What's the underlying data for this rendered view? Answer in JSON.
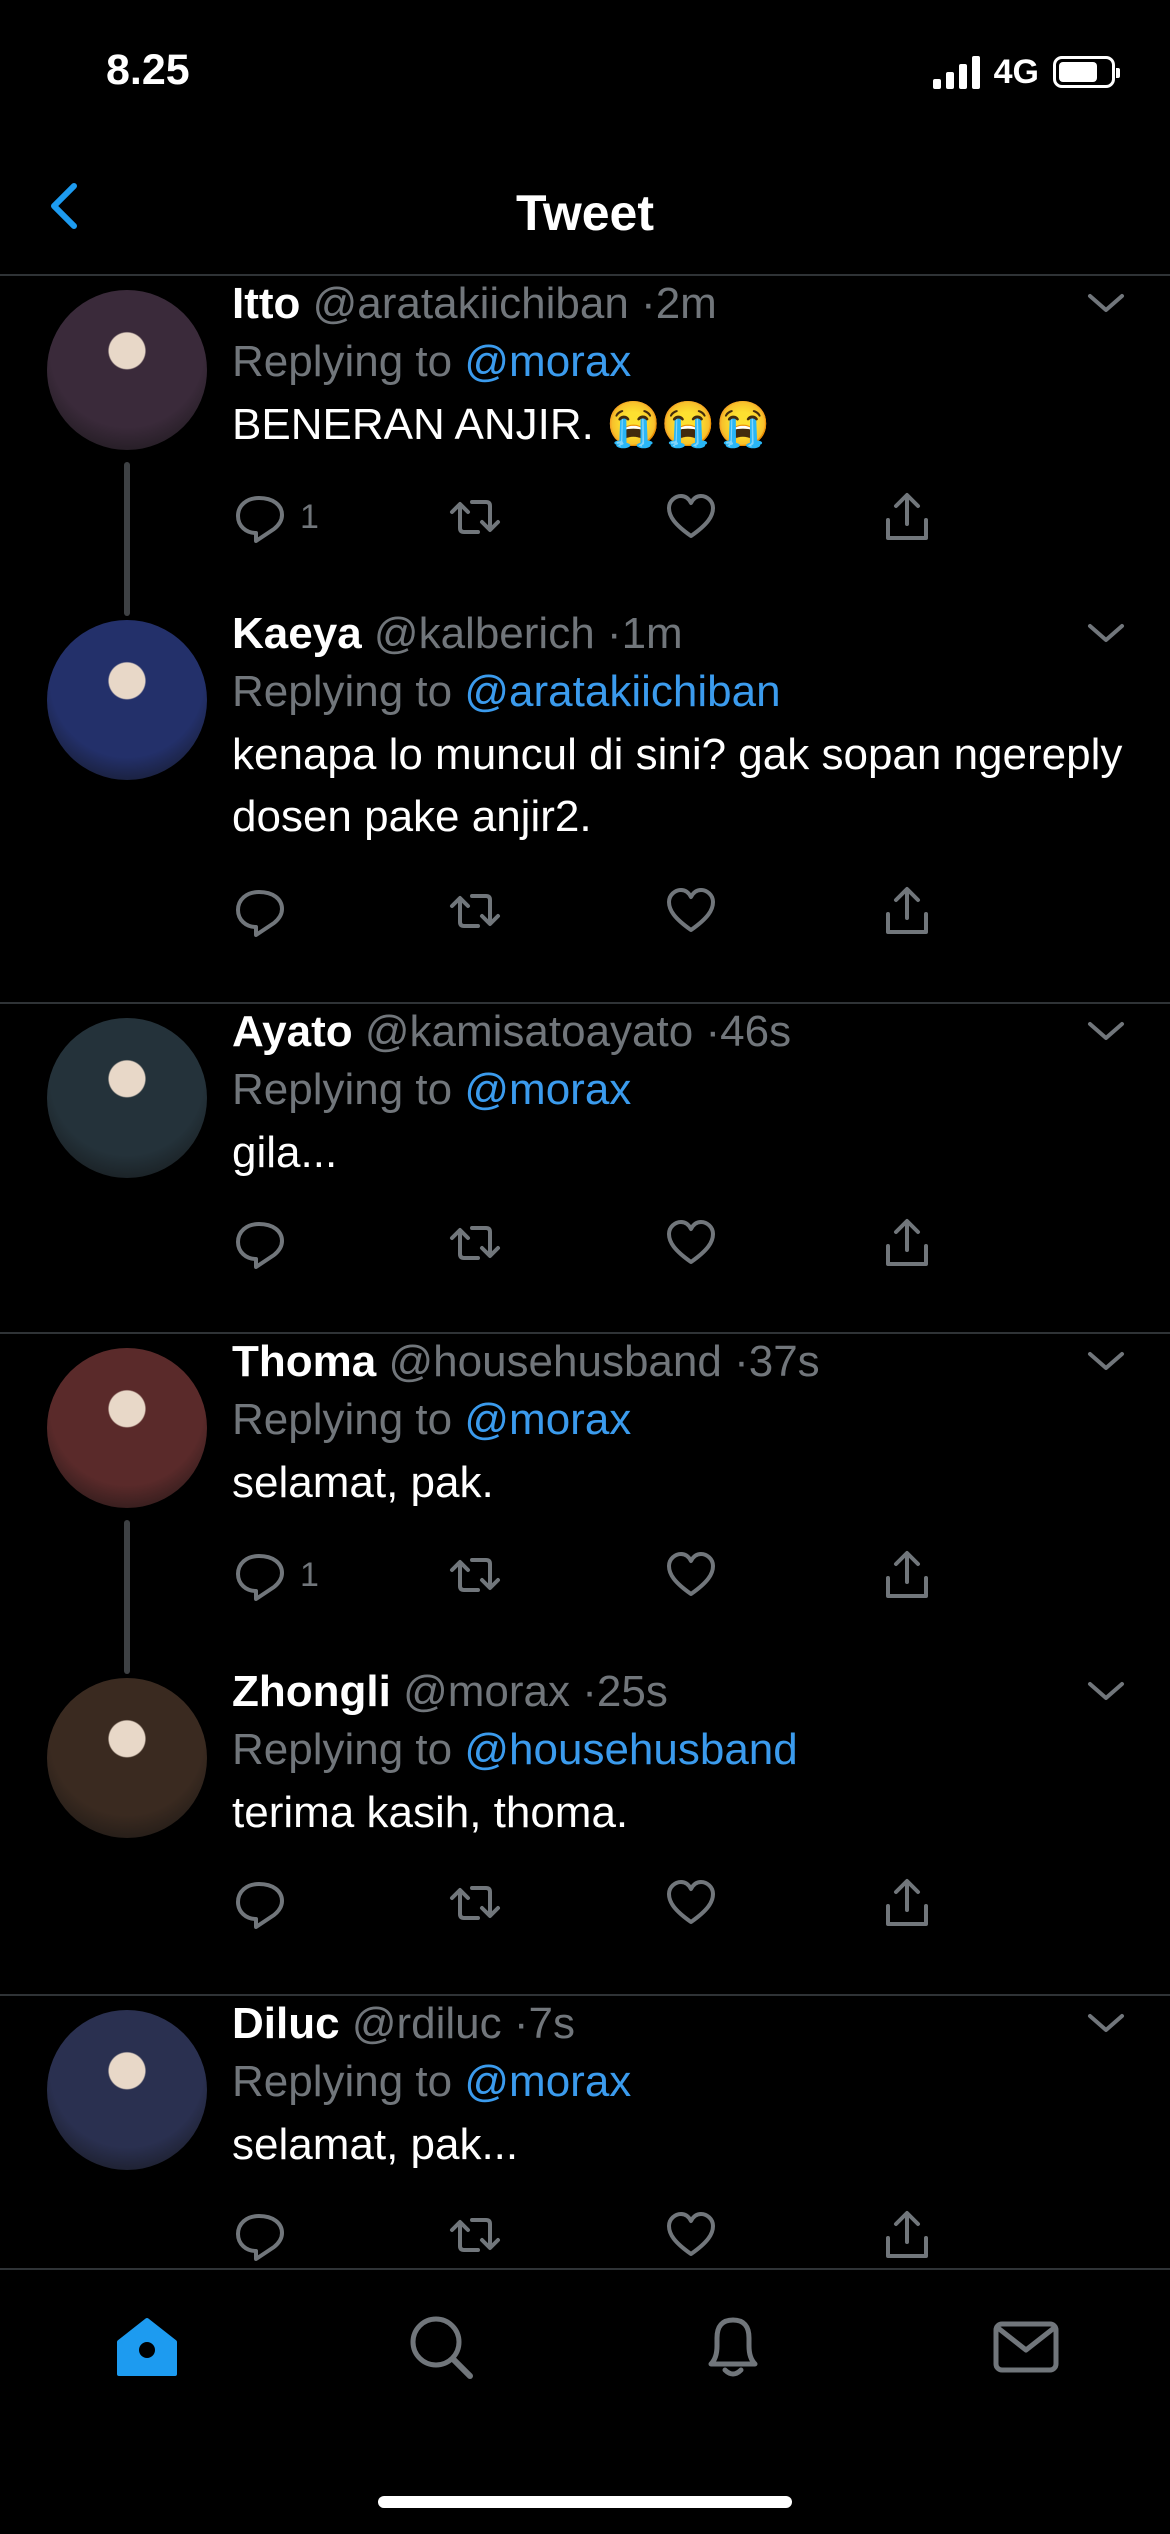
{
  "status_bar": {
    "time": "8.25",
    "network": "4G",
    "battery_level": 0.75
  },
  "header": {
    "title": "Tweet",
    "back_icon": "chevron-left-icon"
  },
  "tweets": [
    {
      "name": "Itto",
      "handle": "@aratakiichiban",
      "time": "2m",
      "replying_prefix": "Replying to",
      "replying_to": "@morax",
      "text": "BENERAN ANJIR. 😭😭😭",
      "reply_count": "1",
      "avatar_color": "#3a2a3a"
    },
    {
      "name": "Kaeya",
      "handle": "@kalberich",
      "time": "1m",
      "replying_prefix": "Replying to",
      "replying_to": "@aratakiichiban",
      "text": "kenapa lo muncul di sini? gak sopan ngereply dosen pake anjir2.",
      "reply_count": "",
      "avatar_color": "#23306a"
    },
    {
      "name": "Ayato",
      "handle": "@kamisatoayato",
      "time": "46s",
      "replying_prefix": "Replying to",
      "replying_to": "@morax",
      "text": "gila...",
      "reply_count": "",
      "avatar_color": "#24323a"
    },
    {
      "name": "Thoma",
      "handle": "@househusband",
      "time": "37s",
      "replying_prefix": "Replying to",
      "replying_to": "@morax",
      "text": "selamat, pak.",
      "reply_count": "1",
      "avatar_color": "#5a2a2a"
    },
    {
      "name": "Zhongli",
      "handle": "@morax",
      "time": "25s",
      "replying_prefix": "Replying to",
      "replying_to": "@househusband",
      "text": "terima kasih, thoma.",
      "reply_count": "",
      "avatar_color": "#3a2a20"
    },
    {
      "name": "Diluc",
      "handle": "@rdiluc",
      "time": "7s",
      "replying_prefix": "Replying to",
      "replying_to": "@morax",
      "text": "selamat, pak...",
      "reply_count": "",
      "avatar_color": "#2a3050"
    }
  ],
  "tabs": [
    {
      "name": "home",
      "icon": "home-icon",
      "active": true
    },
    {
      "name": "search",
      "icon": "search-icon",
      "active": false
    },
    {
      "name": "notifications",
      "icon": "bell-icon",
      "active": false
    },
    {
      "name": "messages",
      "icon": "mail-icon",
      "active": false
    }
  ],
  "colors": {
    "accent": "#1d9bf0",
    "mention": "#3b9bed",
    "muted": "#71767b",
    "divider": "#2f3336"
  }
}
